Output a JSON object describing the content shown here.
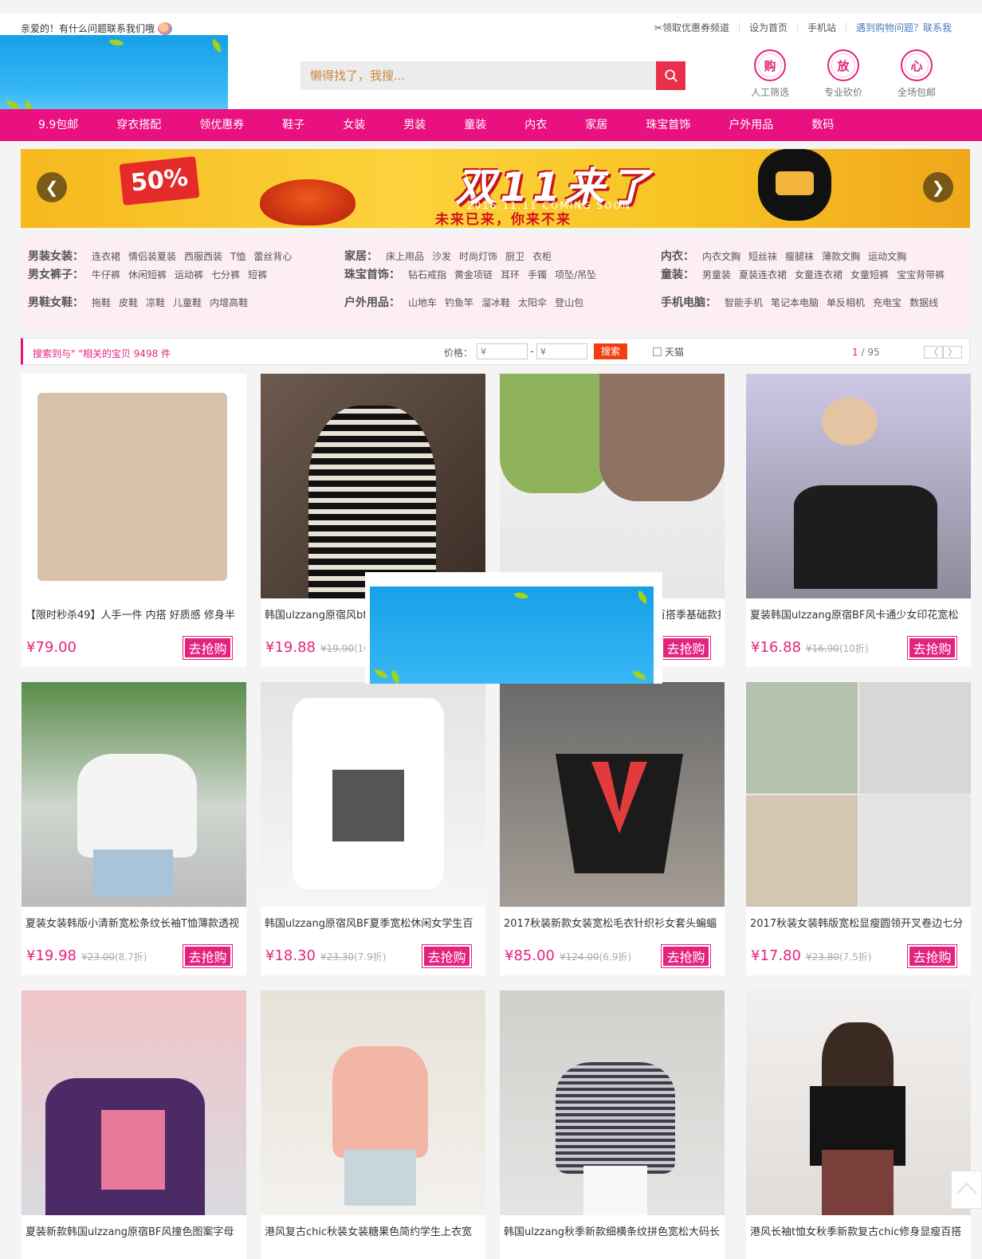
{
  "header": {
    "greeting": "亲爱的！有什么问题联系我们哦",
    "links": [
      "✂领取优惠券频道",
      "设为首页",
      "手机站",
      "遇到购物问题？联系我"
    ],
    "search_placeholder": "懒得找了，我搜...",
    "features": [
      {
        "icon": "购",
        "label": "人工筛选"
      },
      {
        "icon": "放",
        "label": "专业砍价"
      },
      {
        "icon": "心",
        "label": "全场包邮"
      }
    ]
  },
  "nav": [
    "9.9包邮",
    "穿衣搭配",
    "领优惠券",
    "鞋子",
    "女装",
    "男装",
    "童装",
    "内衣",
    "家居",
    "珠宝首饰",
    "户外用品",
    "数码"
  ],
  "banner": {
    "discount": "50%",
    "headline": "双11来了",
    "date_text": "2016.11.11  COMING SOON",
    "subline": "未来已来，你来不来",
    "prev": "❮",
    "next": "❯"
  },
  "categories": [
    [
      {
        "title": "男装女装：",
        "items": [
          "连衣裙",
          "情侣装夏装",
          "西服西装",
          "T恤",
          "蕾丝背心"
        ]
      },
      {
        "title": "男女裤子：",
        "items": [
          "牛仔裤",
          "休闲短裤",
          "运动裤",
          "七分裤",
          "短裤"
        ]
      },
      {
        "title": "男鞋女鞋：",
        "items": [
          "拖鞋",
          "皮鞋",
          "凉鞋",
          "儿童鞋",
          "内增高鞋"
        ]
      }
    ],
    [
      {
        "title": "家居：",
        "items": [
          "床上用品",
          "沙发",
          "时尚灯饰",
          "厨卫",
          "衣柜"
        ]
      },
      {
        "title": "珠宝首饰：",
        "items": [
          "钻石戒指",
          "黄金项链",
          "耳环",
          "手镯",
          "项坠/吊坠"
        ]
      },
      {
        "title": "户外用品：",
        "items": [
          "山地车",
          "钓鱼竿",
          "溜冰鞋",
          "太阳伞",
          "登山包"
        ]
      }
    ],
    [
      {
        "title": "内衣：",
        "items": [
          "内衣文胸",
          "短丝袜",
          "瘦腿袜",
          "薄款文胸",
          "运动文胸"
        ]
      },
      {
        "title": "童装：",
        "items": [
          "男童装",
          "夏装连衣裙",
          "女童连衣裙",
          "女童短裤",
          "宝宝背带裤"
        ]
      },
      {
        "title": "手机电脑：",
        "items": [
          "智能手机",
          "笔记本电脑",
          "单反相机",
          "充电宝",
          "数据线"
        ]
      }
    ]
  ],
  "filter": {
    "result_text": "搜索到与\" \"相关的宝贝 9498 件",
    "price_label": "价格：",
    "min_placeholder": "¥",
    "max_placeholder": "¥",
    "dash": "-",
    "search_btn": "搜索",
    "tmall_label": "天猫",
    "page_current": "1",
    "page_total": "/ 95",
    "prev": "〈",
    "next": "〉"
  },
  "buy_label": "去抢购",
  "products": [
    {
      "title": "【限时秒杀49】人手一件 内搭 好质感 修身半",
      "price": "¥79.00",
      "old": "",
      "disc": ""
    },
    {
      "title": "韩国ulzzang原宿风bf风条纹宽松长袖T恤女",
      "price": "¥19.88",
      "old": "¥19.90",
      "disc": "(10"
    },
    {
      "title": "夏季韩版宽松纯色短袖T恤女学生百搭季基础款打",
      "price": "",
      "old": "",
      "disc": ""
    },
    {
      "title": "夏装韩国ulzzang原宿BF风卡通少女印花宽松",
      "price": "¥16.88",
      "old": "¥16.90",
      "disc": "(10折)"
    },
    {
      "title": "夏装女装韩版小清新宽松条纹长袖T恤薄款透视",
      "price": "¥19.98",
      "old": "¥23.00",
      "disc": "(8.7折)"
    },
    {
      "title": "韩国ulzzang原宿风BF夏季宽松休闲女学生百",
      "price": "¥18.30",
      "old": "¥23.30",
      "disc": "(7.9折)"
    },
    {
      "title": "2017秋装新款女装宽松毛衣针织衫女套头蝙蝠",
      "price": "¥85.00",
      "old": "¥124.00",
      "disc": "(6.9折)"
    },
    {
      "title": "2017秋装女装韩版宽松显瘦圆领开叉卷边七分",
      "price": "¥17.80",
      "old": "¥23.80",
      "disc": "(7.5折)"
    },
    {
      "title": "夏装新款韩国ulzzang原宿BF风撞色图案字母",
      "price": "",
      "old": "",
      "disc": ""
    },
    {
      "title": "港风复古chic秋装女装糖果色简约学生上衣宽",
      "price": "",
      "old": "",
      "disc": ""
    },
    {
      "title": "韩国ulzzang秋季新款细横条纹拼色宽松大码长",
      "price": "",
      "old": "",
      "disc": ""
    },
    {
      "title": "港风长袖t恤女秋季新款复古chic修身显瘦百搭",
      "price": "",
      "old": "",
      "disc": ""
    }
  ],
  "colors": {
    "brand": "#e8117f",
    "accent": "#e3237e",
    "search_btn": "#e8304a"
  }
}
